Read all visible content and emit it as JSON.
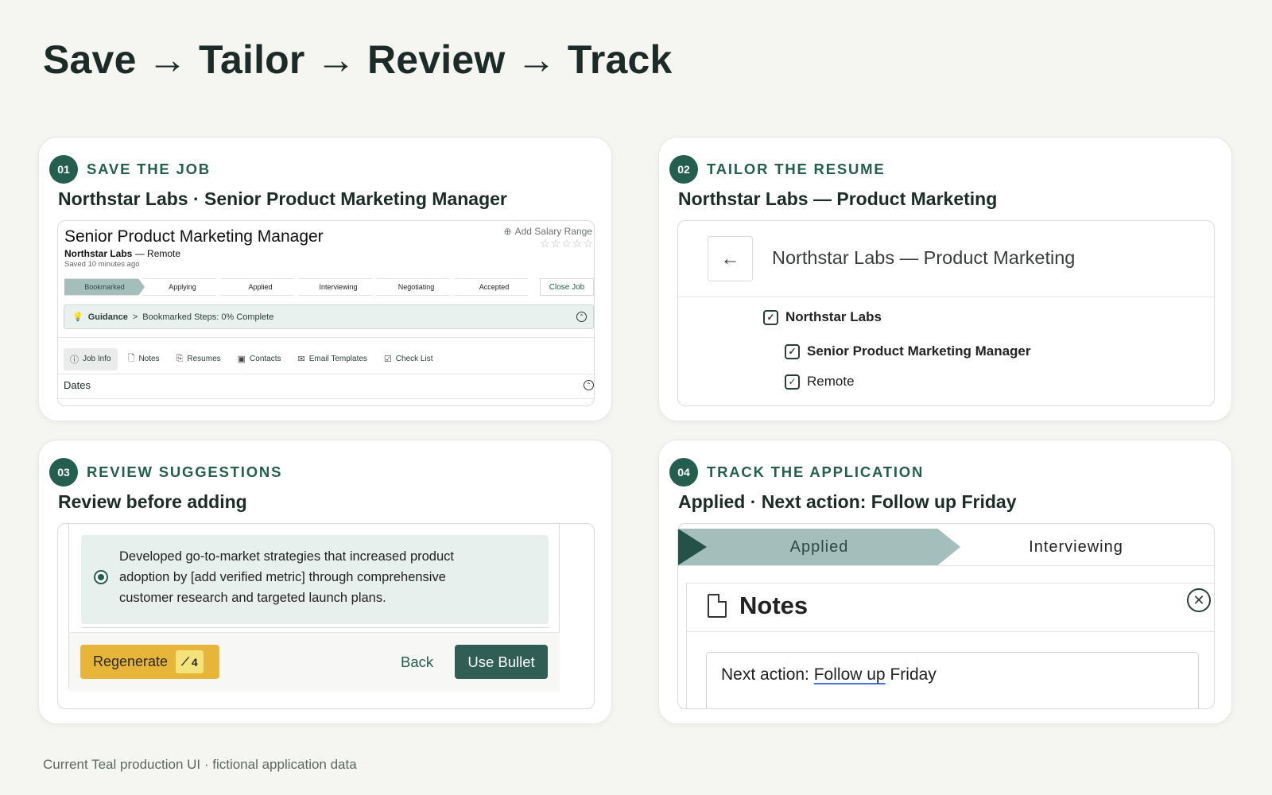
{
  "page": {
    "title": "Save → Tailor → Review → Track",
    "footer": "Current Teal production UI · fictional application data"
  },
  "steps": [
    {
      "number": "01",
      "label": "SAVE THE JOB",
      "subtitle": "Northstar Labs · Senior Product Marketing Manager",
      "job": {
        "title": "Senior Product Marketing Manager",
        "company": "Northstar Labs",
        "location_suffix": " — Remote",
        "saved": "Saved 10 minutes ago",
        "salary_link": "Add Salary Range",
        "rating_stars": "☆☆☆☆☆",
        "pipeline": [
          "Bookmarked",
          "Applying",
          "Applied",
          "Interviewing",
          "Negotiating",
          "Accepted"
        ],
        "pipeline_active": "Bookmarked",
        "close_job": "Close Job",
        "guidance_label": "Guidance",
        "guidance_caret": ">",
        "guidance_text": "Bookmarked Steps: 0% Complete",
        "tabs": [
          "Job Info",
          "Notes",
          "Resumes",
          "Contacts",
          "Email Templates",
          "Check List"
        ],
        "tab_icons": [
          "info-icon",
          "document-icon",
          "paperclip-icon",
          "contact-card-icon",
          "mail-icon",
          "checkbox-icon"
        ],
        "section": "Dates"
      }
    },
    {
      "number": "02",
      "label": "TAILOR THE RESUME",
      "subtitle": "Northstar Labs — Product Marketing",
      "frame_title": "Northstar Labs — Product Marketing",
      "checks": {
        "parent": "Northstar Labs",
        "child1": "Senior Product Marketing Manager",
        "child2": "Remote"
      }
    },
    {
      "number": "03",
      "label": "REVIEW SUGGESTIONS",
      "subtitle": "Review before adding",
      "suggestion": "Developed go-to-market strategies that increased product adoption by [add verified metric] through comprehensive customer research and targeted launch plans.",
      "regenerate": "Regenerate",
      "regen_count": "4",
      "back": "Back",
      "use_bullet": "Use Bullet"
    },
    {
      "number": "04",
      "label": "TRACK THE APPLICATION",
      "subtitle": "Applied · Next action: Follow up Friday",
      "stage_active": "Applied",
      "stage_next": "Interviewing",
      "notes_title": "Notes",
      "note_prefix": "Next action: ",
      "note_underlined": "Follow up",
      "note_suffix": " Friday"
    }
  ],
  "colors": {
    "accent": "#245e4f",
    "pipeline_active": "#a3bebb",
    "regenerate": "#e7b53a",
    "use_bullet": "#315e54",
    "background": "#f5f6f2"
  }
}
